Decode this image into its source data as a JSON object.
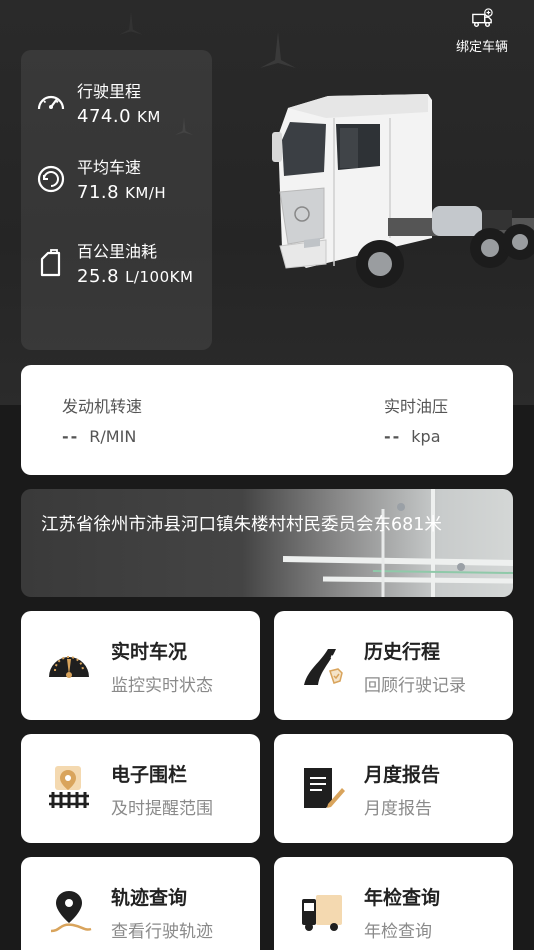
{
  "header": {
    "bind_label": "绑定车辆",
    "bind_icon": "truck-add-icon"
  },
  "stats": [
    {
      "icon": "speedometer-icon",
      "label": "行驶里程",
      "value": "474.0",
      "unit": "KM"
    },
    {
      "icon": "average-speed-icon",
      "label": "平均车速",
      "value": "71.8",
      "unit": "KM/H"
    },
    {
      "icon": "fuel-can-icon",
      "label": "百公里油耗",
      "value": "25.8",
      "unit": "L/100KM"
    }
  ],
  "engine": {
    "rpm_label": "发动机转速",
    "rpm_value": "--",
    "rpm_unit": "R/MIN",
    "oil_label": "实时油压",
    "oil_value": "--",
    "oil_unit": "kpa"
  },
  "location": {
    "address": "江苏省徐州市沛县河口镇朱楼村村民委员会东681米"
  },
  "tiles": [
    {
      "icon": "gauge-icon",
      "title": "实时车况",
      "subtitle": "监控实时状态"
    },
    {
      "icon": "road-icon",
      "title": "历史行程",
      "subtitle": "回顾行驶记录"
    },
    {
      "icon": "geofence-icon",
      "title": "电子围栏",
      "subtitle": "及时提醒范围"
    },
    {
      "icon": "report-icon",
      "title": "月度报告",
      "subtitle": "月度报告"
    },
    {
      "icon": "track-pin-icon",
      "title": "轨迹查询",
      "subtitle": "查看行驶轨迹"
    },
    {
      "icon": "inspection-truck-icon",
      "title": "年检查询",
      "subtitle": "年检查询"
    }
  ],
  "colors": {
    "accent": "#d9a45c",
    "card": "#ffffff",
    "dark_bg": "#1a1a1a"
  }
}
